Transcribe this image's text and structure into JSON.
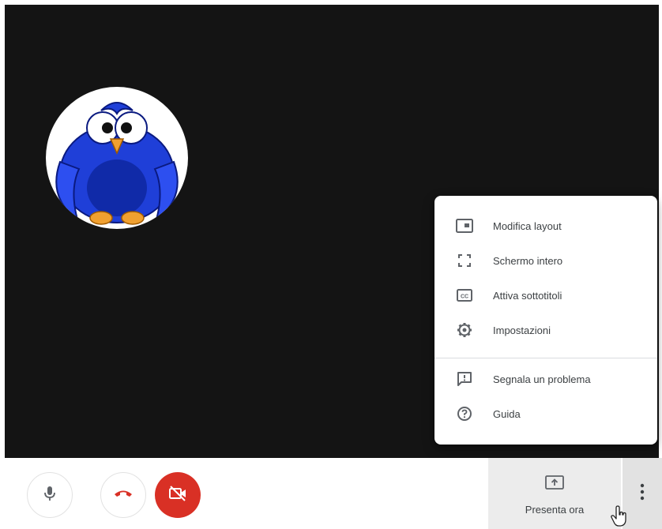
{
  "menu": {
    "items": [
      {
        "label": "Modifica layout",
        "icon": "layout-icon"
      },
      {
        "label": "Schermo intero",
        "icon": "fullscreen-icon"
      },
      {
        "label": "Attiva sottotitoli",
        "icon": "closed-captions-icon"
      },
      {
        "label": "Impostazioni",
        "icon": "gear-icon"
      },
      {
        "label": "Segnala un problema",
        "icon": "report-problem-icon"
      },
      {
        "label": "Guida",
        "icon": "help-icon"
      }
    ]
  },
  "controls": {
    "mic_icon": "microphone-icon",
    "hangup_icon": "hang-up-icon",
    "camera_icon": "camera-off-icon",
    "present_label": "Presenta ora",
    "present_icon": "present-screen-icon",
    "more_icon": "more-vert-icon"
  },
  "colors": {
    "stage_background": "#141414",
    "danger": "#d93025",
    "text": "#3c4043",
    "avatar_bird": "#1f3fd8"
  }
}
